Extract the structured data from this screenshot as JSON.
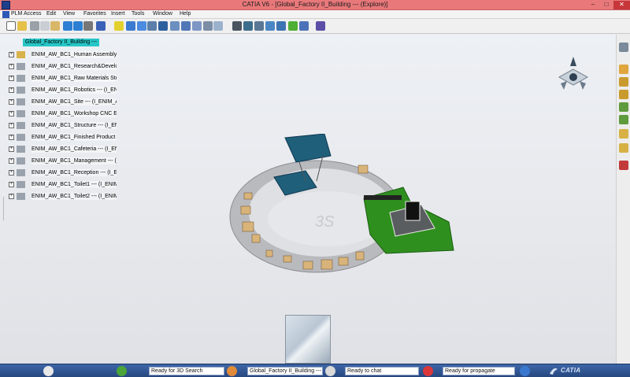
{
  "window": {
    "title": "CATIA V6 - [Global_Factory II_Building --- (Explore)]",
    "minimize_glyph": "–",
    "maximize_glyph": "□",
    "close_glyph": "✕",
    "title_color": "#e8787a"
  },
  "menu": {
    "items": [
      "PLM Access",
      "Edit",
      "View",
      "Favorites",
      "Insert",
      "Tools",
      "Window",
      "Help"
    ]
  },
  "tree": {
    "root_label": "Global_Factory II_Building ---",
    "expander_glyph": "+",
    "items": [
      {
        "label": "ENIM_AW_BC1_Human Assembly A",
        "icon": "product-icon"
      },
      {
        "label": "ENIM_AW_BC1_Research&Develop",
        "icon": "part-icon"
      },
      {
        "label": "ENIM_AW_BC1_Raw Materials Stoc",
        "icon": "part-icon"
      },
      {
        "label": "ENIM_AW_BC1_Robotics --- (I_EN",
        "icon": "part-icon"
      },
      {
        "label": "ENIM_AW_BC1_Site --- (I_ENIM_A\\",
        "icon": "part-icon"
      },
      {
        "label": "ENIM_AW_BC1_Workshop CNC EN",
        "icon": "part-icon"
      },
      {
        "label": "ENIM_AW_BC1_Structure --- (I_EN",
        "icon": "part-icon"
      },
      {
        "label": "ENIM_AW_BC1_Finished Product S",
        "icon": "part-icon"
      },
      {
        "label": "ENIM_AW_BC1_Cafeteria --- (I_EN",
        "icon": "part-icon"
      },
      {
        "label": "ENIM_AW_BC1_Management --- (",
        "icon": "part-icon"
      },
      {
        "label": "ENIM_AW_BC1_Reception --- (I_EN",
        "icon": "part-icon"
      },
      {
        "label": "ENIM_AW_BC1_Toilet1 --- (I_ENIM",
        "icon": "part-icon"
      },
      {
        "label": "ENIM_AW_BC1_Toilet2 --- (I_ENIM",
        "icon": "part-icon"
      }
    ]
  },
  "status_bar": {
    "search_field": "Ready for 3D Search",
    "document_field": "Global_Factory II_Building ---",
    "chat_field": "Ready to chat",
    "propagate_field": "Ready for propagate",
    "brand": "CATIA",
    "scene_logo": "3S"
  },
  "colors": {
    "selection": "#27c6c6",
    "ground_green": "#2f8f1e",
    "roof_blue": "#1f5f7a",
    "platform": "#d8d9dc"
  }
}
